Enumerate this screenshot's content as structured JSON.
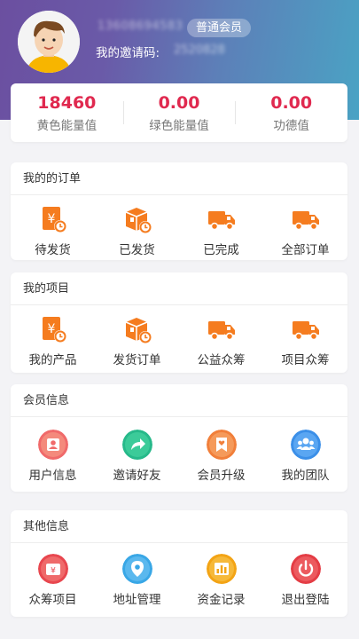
{
  "profile": {
    "user_id": "13608694583",
    "member_level": "普通会员",
    "invite_label": "我的邀请码:",
    "invite_code": "2520828"
  },
  "stats": [
    {
      "value": "18460",
      "label": "黄色能量值"
    },
    {
      "value": "0.00",
      "label": "绿色能量值"
    },
    {
      "value": "0.00",
      "label": "功德值"
    }
  ],
  "orders": {
    "title": "我的的订单",
    "items": [
      {
        "label": "待发货",
        "icon": "yen-receipt-icon"
      },
      {
        "label": "已发货",
        "icon": "package-icon"
      },
      {
        "label": "已完成",
        "icon": "truck-icon"
      },
      {
        "label": "全部订单",
        "icon": "truck-icon"
      }
    ]
  },
  "projects": {
    "title": "我的项目",
    "items": [
      {
        "label": "我的产品",
        "icon": "yen-receipt-icon"
      },
      {
        "label": "发货订单",
        "icon": "package-icon"
      },
      {
        "label": "公益众筹",
        "icon": "truck-icon"
      },
      {
        "label": "项目众筹",
        "icon": "truck-icon"
      }
    ]
  },
  "member": {
    "title": "会员信息",
    "items": [
      {
        "label": "用户信息",
        "icon": "user-info-icon"
      },
      {
        "label": "邀请好友",
        "icon": "share-arrow-icon"
      },
      {
        "label": "会员升级",
        "icon": "heart-badge-icon"
      },
      {
        "label": "我的团队",
        "icon": "team-icon"
      }
    ]
  },
  "other": {
    "title": "其他信息",
    "items": [
      {
        "label": "众筹项目",
        "icon": "wallet-icon"
      },
      {
        "label": "地址管理",
        "icon": "location-pin-icon"
      },
      {
        "label": "资金记录",
        "icon": "bar-chart-icon"
      },
      {
        "label": "退出登陆",
        "icon": "power-icon"
      }
    ]
  },
  "colors": {
    "accent_red": "#e0294f",
    "icon_orange": "#f57c1f"
  }
}
